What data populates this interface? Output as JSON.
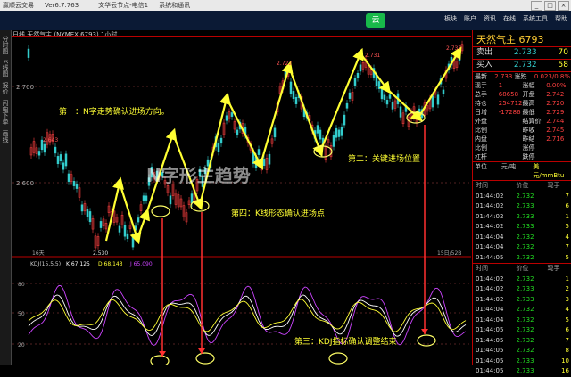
{
  "window": {
    "title_items": [
      "赢顺云交易",
      "Ver6.7.763",
      "文华云节点-电信1",
      "系统和通讯"
    ],
    "buttons": [
      "_",
      "□",
      "×"
    ]
  },
  "menu": {
    "logo": "云",
    "items": [
      "板块",
      "账户",
      "资讯",
      "在线",
      "系统工具",
      "帮助"
    ]
  },
  "left_tabs": [
    "分时图",
    "K线图",
    "报价",
    "闪电下单",
    "画线"
  ],
  "chart": {
    "header": "日线 天然气主 (NYMEX 6793) 1小时",
    "price_labels": [
      "2.700",
      "2.600"
    ],
    "peak_labels": [
      "2.643",
      "2.722",
      "2.731",
      "2.737"
    ],
    "low_label": "2.530",
    "date_label_left": "16天",
    "date_label_right": "15日/52B",
    "kdj_header": "KDJ(15,5,5)",
    "kdj_k": "K 67.125",
    "kdj_d": "D 68.143",
    "kdj_j": "J 65.090",
    "kdj_ticks": [
      "80",
      "50",
      "20"
    ],
    "annotations": [
      "第一：N字走势确认进场方向。",
      "第二：关键进场位置",
      "第四：K线形态确认进场点",
      "第三：KDJ指标确认调整结束"
    ],
    "big_blur_text": "N字形主趋势"
  },
  "right_panel": {
    "symbol": "天然气主 6793",
    "sell_label": "卖出",
    "sell_price": "2.733",
    "sell_vol": "70",
    "buy_label": "买入",
    "buy_price": "2.732",
    "buy_vol": "58",
    "stats": [
      [
        "最新",
        "2.733",
        "涨跌",
        "0.023/0.8%"
      ],
      [
        "现手",
        "1",
        "涨幅",
        "0.00%"
      ],
      [
        "总手",
        "68658",
        "开盘",
        "2.742"
      ],
      [
        "持仓",
        "254712",
        "最高",
        "2.720"
      ],
      [
        "日增",
        "-17286",
        "最低",
        "2.729"
      ],
      [
        "外盘",
        "",
        "结算价",
        "2.744"
      ],
      [
        "比例",
        "",
        "昨收",
        "2.745"
      ],
      [
        "内盘",
        "",
        "昨结",
        "2.716"
      ],
      [
        "比例",
        "",
        "涨停",
        ""
      ],
      [
        "杠杆",
        "",
        "跌停",
        ""
      ]
    ],
    "unit_row": [
      "单位",
      "元/吨",
      "美元/mmBtu"
    ],
    "tick_headers": [
      "时间",
      "价位",
      "现手"
    ],
    "ticks1": [
      [
        "01:44:02",
        "2.732",
        "7"
      ],
      [
        "01:44:02",
        "2.733",
        "6"
      ],
      [
        "01:44:02",
        "2.733",
        "1"
      ],
      [
        "01:44:02",
        "2.733",
        "5"
      ],
      [
        "01:44:04",
        "2.732",
        "4"
      ],
      [
        "01:44:04",
        "2.732",
        "7"
      ],
      [
        "01:44:05",
        "2.732",
        "5"
      ]
    ],
    "ticks2": [
      [
        "01:44:02",
        "2.732",
        "1"
      ],
      [
        "01:44:02",
        "2.733",
        "2"
      ],
      [
        "01:44:02",
        "2.733",
        "3"
      ],
      [
        "01:44:04",
        "2.732",
        "4"
      ],
      [
        "01:44:04",
        "2.732",
        "5"
      ],
      [
        "01:44:05",
        "2.732",
        "6"
      ],
      [
        "01:44:05",
        "2.732",
        "7"
      ],
      [
        "01:44:05",
        "2.732",
        "8"
      ],
      [
        "01:44:05",
        "2.733",
        "10"
      ],
      [
        "01:44:05",
        "2.733",
        "16"
      ]
    ],
    "colors": {
      "up": "#ff4040",
      "down": "#22dd22",
      "arrow": "#ffff33",
      "annotation": "#ffff33"
    }
  }
}
